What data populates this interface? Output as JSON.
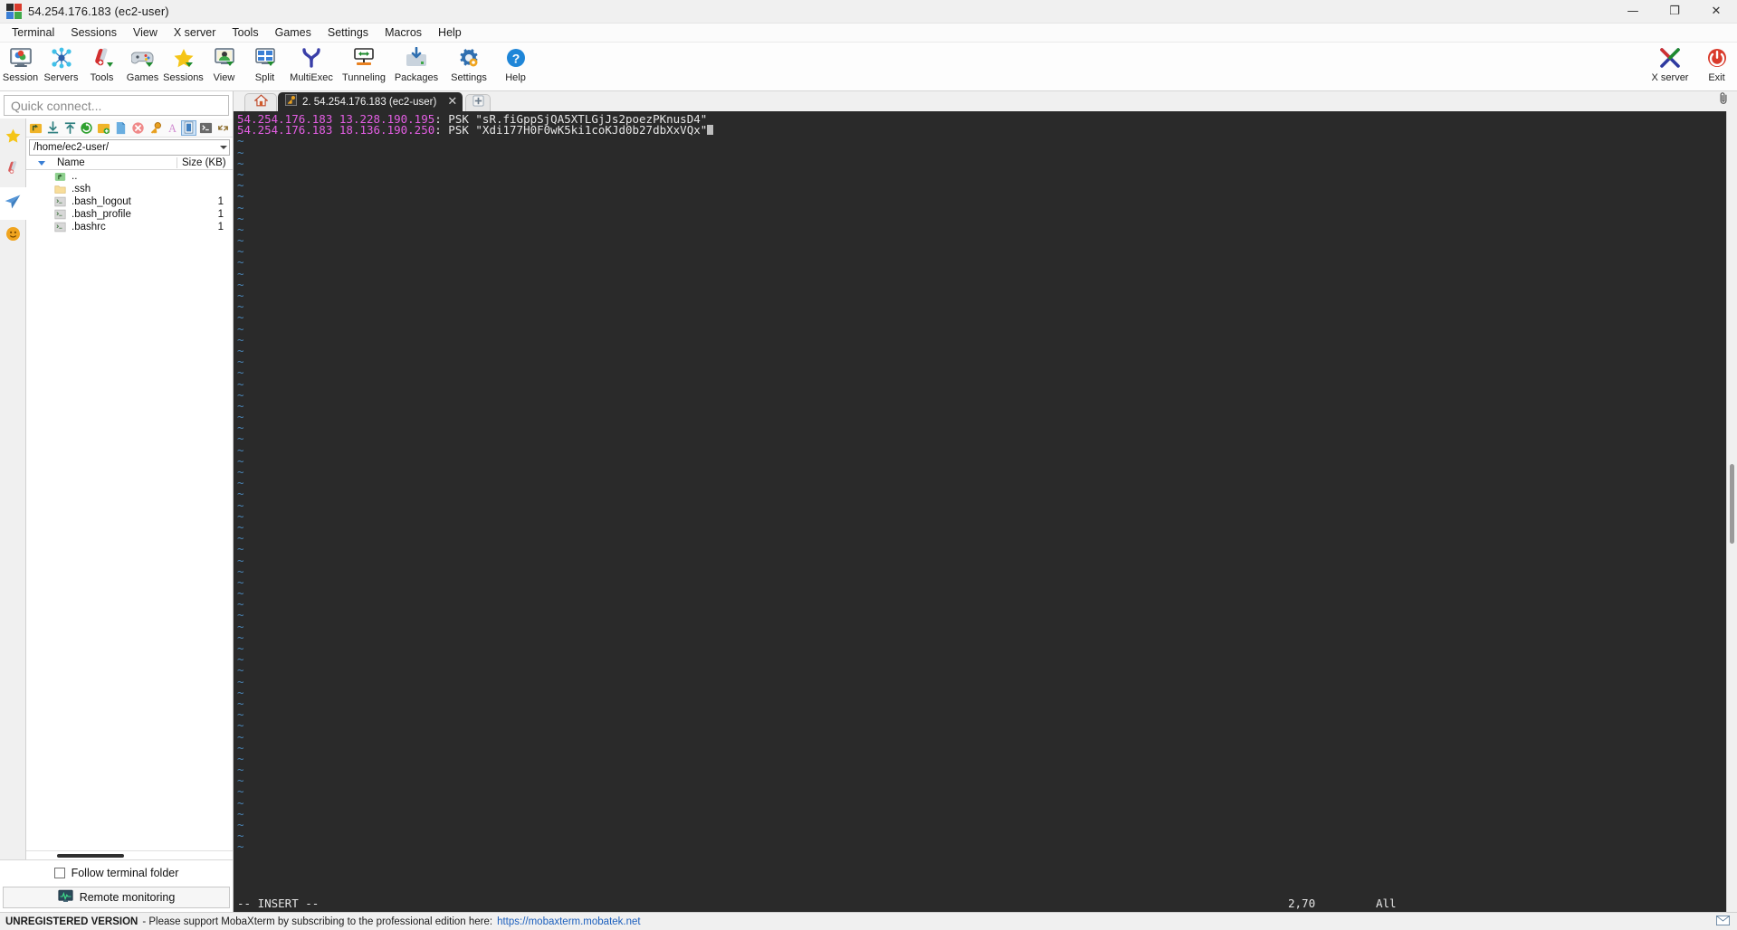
{
  "window": {
    "title": "54.254.176.183 (ec2-user)",
    "icon": "mobaxterm-logo-icon",
    "buttons": {
      "minimize": "—",
      "maximize": "❐",
      "close": "✕"
    }
  },
  "menubar": {
    "items": [
      {
        "label": "Terminal",
        "name": "menu-terminal"
      },
      {
        "label": "Sessions",
        "name": "menu-sessions"
      },
      {
        "label": "View",
        "name": "menu-view"
      },
      {
        "label": "X server",
        "name": "menu-x-server"
      },
      {
        "label": "Tools",
        "name": "menu-tools"
      },
      {
        "label": "Games",
        "name": "menu-games"
      },
      {
        "label": "Settings",
        "name": "menu-settings"
      },
      {
        "label": "Macros",
        "name": "menu-macros"
      },
      {
        "label": "Help",
        "name": "menu-help"
      }
    ]
  },
  "toolbar": {
    "buttons": [
      {
        "label": "Session",
        "icon": "session-monitor-icon"
      },
      {
        "label": "Servers",
        "icon": "servers-network-icon"
      },
      {
        "label": "Tools",
        "icon": "tools-swissknife-icon"
      },
      {
        "label": "Games",
        "icon": "games-gamepad-icon"
      },
      {
        "label": "Sessions",
        "icon": "sessions-star-icon"
      },
      {
        "label": "View",
        "icon": "view-monitor-icon"
      },
      {
        "label": "Split",
        "icon": "split-panes-icon"
      },
      {
        "label": "MultiExec",
        "icon": "multiexec-fork-icon"
      },
      {
        "label": "Tunneling",
        "icon": "tunneling-arrows-icon"
      },
      {
        "label": "Packages",
        "icon": "packages-download-icon"
      },
      {
        "label": "Settings",
        "icon": "settings-gear-icon"
      },
      {
        "label": "Help",
        "icon": "help-question-icon"
      }
    ],
    "right": [
      {
        "label": "X server",
        "icon": "x-server-icon"
      },
      {
        "label": "Exit",
        "icon": "exit-power-icon"
      }
    ]
  },
  "sidebar": {
    "quick_connect": {
      "placeholder": "Quick connect...",
      "value": ""
    },
    "vertical_tabs": [
      {
        "name": "sessions-tab",
        "icon": "star-icon",
        "active": false
      },
      {
        "name": "tools-tab",
        "icon": "swissknife-icon",
        "active": false
      },
      {
        "name": "sftp-tab",
        "icon": "paperplane-icon",
        "active": true
      },
      {
        "name": "macros-tab",
        "icon": "smiley-icon",
        "active": false
      }
    ],
    "sftp_toolbar": [
      {
        "name": "parent-folder-icon"
      },
      {
        "name": "download-icon"
      },
      {
        "name": "upload-icon"
      },
      {
        "name": "refresh-icon"
      },
      {
        "name": "new-folder-icon"
      },
      {
        "name": "new-file-icon"
      },
      {
        "name": "delete-icon"
      },
      {
        "name": "permissions-key-icon"
      },
      {
        "name": "text-mode-icon"
      },
      {
        "name": "binary-mode-icon"
      },
      {
        "name": "terminal-link-icon"
      },
      {
        "name": "expand-icon"
      }
    ],
    "path": "/home/ec2-user/",
    "columns": {
      "name": "Name",
      "size": "Size (KB)"
    },
    "files": [
      {
        "name": "..",
        "size": "",
        "icon": "parent-dir-icon"
      },
      {
        "name": ".ssh",
        "size": "",
        "icon": "folder-icon"
      },
      {
        "name": ".bash_logout",
        "size": "1",
        "icon": "script-file-icon"
      },
      {
        "name": ".bash_profile",
        "size": "1",
        "icon": "script-file-icon"
      },
      {
        "name": ".bashrc",
        "size": "1",
        "icon": "script-file-icon"
      }
    ],
    "follow_terminal_folder": {
      "label": "Follow terminal folder",
      "checked": false
    },
    "remote_monitoring": {
      "label": "Remote monitoring",
      "icon": "monitoring-chart-icon"
    }
  },
  "tabs": {
    "home": {
      "name": "home-tab",
      "icon": "home-icon"
    },
    "active": {
      "label": "2. 54.254.176.183 (ec2-user)",
      "icon": "terminal-key-icon",
      "close": "✕"
    },
    "new_tab": {
      "icon": "plus-icon"
    },
    "paperclip": {
      "icon": "paperclip-icon"
    }
  },
  "terminal": {
    "lines": [
      {
        "segments": [
          {
            "text": "54.254.176.183",
            "color": "magenta"
          },
          {
            "text": " ",
            "color": "white"
          },
          {
            "text": "13.228.190.195",
            "color": "magenta"
          },
          {
            "text": ": PSK \"sR.fiGppSjQA5XTLGjJs2poezPKnusD4\"",
            "color": "white"
          }
        ]
      },
      {
        "segments": [
          {
            "text": "54.254.176.183",
            "color": "magenta"
          },
          {
            "text": " ",
            "color": "white"
          },
          {
            "text": "18.136.190.250",
            "color": "magenta"
          },
          {
            "text": ": PSK \"Xdi177H0F0wK5ki1coKJd0b27dbXxVQx\"",
            "color": "white"
          }
        ],
        "cursor": true
      }
    ],
    "tilde_rows": 65,
    "tilde_char": "~",
    "status": {
      "mode": "-- INSERT --",
      "position": "2,70",
      "scroll": "All"
    },
    "colors": {
      "background": "#2a2a2a",
      "magenta": "#e45ee4",
      "white": "#e6e6e6",
      "tilde_blue": "#4a86b8"
    }
  },
  "statusbar": {
    "unregistered": "UNREGISTERED VERSION",
    "message": "-  Please support MobaXterm by subscribing to the professional edition here:",
    "link": "https://mobaxterm.mobatek.net",
    "mail_icon": "mail-icon"
  }
}
